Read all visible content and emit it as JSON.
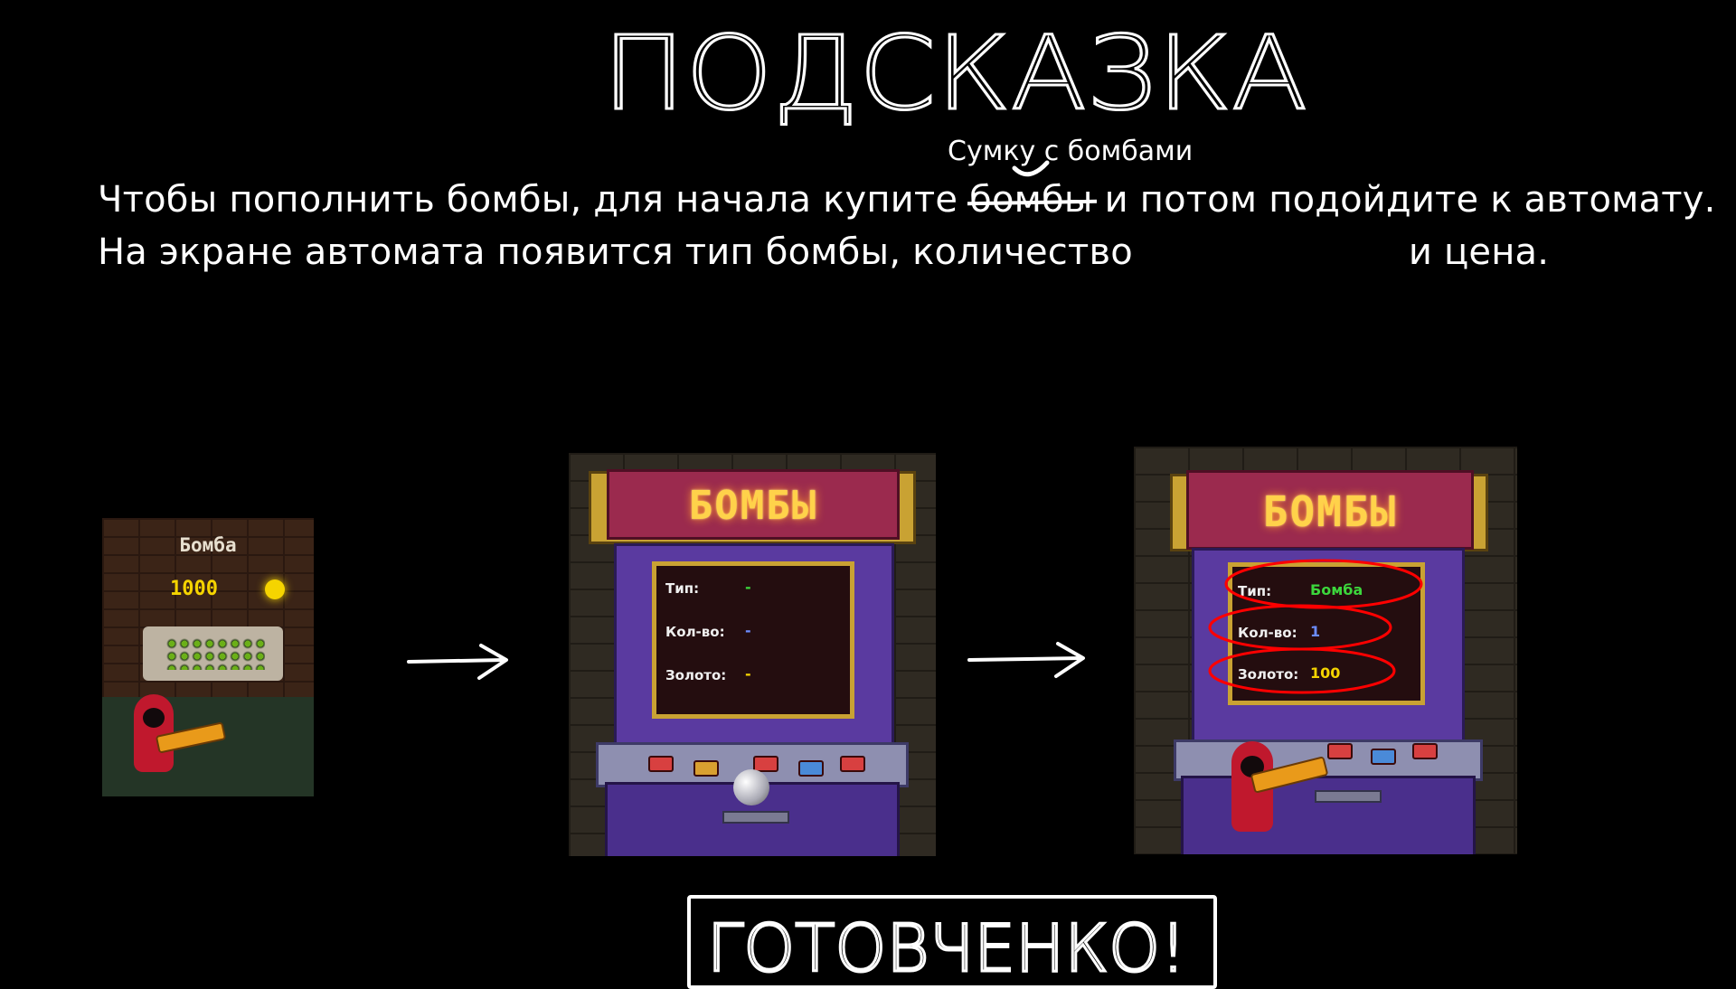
{
  "title": "ПОДСКАЗКА",
  "correction_note": "Сумку с бомбами",
  "instructions": {
    "line1_before": "Чтобы пополнить бомбы, для начала купите ",
    "line1_struck": "бомбы",
    "line1_after": " и потом подойдите к автомату.",
    "line2_before": "На экране автомата появится тип бомбы, количество ",
    "line2_after": "и цена."
  },
  "shop_item": {
    "name": "Бомба",
    "price": "1000"
  },
  "arcade_before": {
    "marquee": "БОМБЫ",
    "type_label": "Тип:",
    "type_value": "-",
    "qty_label": "Кол-во:",
    "qty_value": "-",
    "gold_label": "Золото:",
    "gold_value": "-"
  },
  "arcade_after": {
    "marquee": "БОМБЫ",
    "type_label": "Тип:",
    "type_value": "Бомба",
    "qty_label": "Кол-во:",
    "qty_value": "1",
    "gold_label": "Золото:",
    "gold_value": "100"
  },
  "footer": "ГОТОВЧЕНКО!",
  "colors": {
    "background": "#000000",
    "annotation": "#ff0000",
    "type_value": "#3cd63c",
    "qty_value": "#6c8cff",
    "gold_value": "#f5d400"
  },
  "icons": [
    "arrow-right-icon",
    "coin-icon",
    "bomb-pile-icon",
    "hero-sprite-icon"
  ]
}
